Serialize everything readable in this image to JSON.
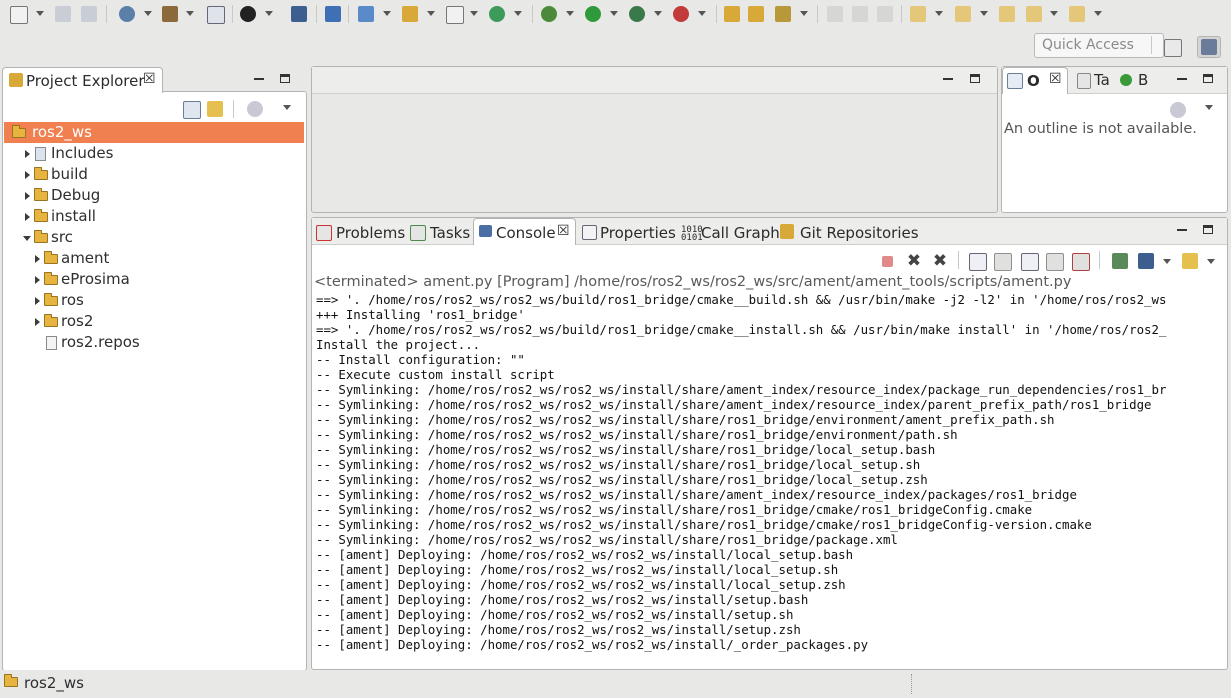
{
  "quick_access": {
    "placeholder": "Quick Access"
  },
  "project_explorer": {
    "title": "Project Explorer",
    "tree": [
      {
        "label": "ros2_ws",
        "kind": "project",
        "selected": true
      },
      {
        "label": "Includes",
        "kind": "includes",
        "expanded": false
      },
      {
        "label": "build",
        "kind": "folder",
        "expanded": false
      },
      {
        "label": "Debug",
        "kind": "folder",
        "expanded": false
      },
      {
        "label": "install",
        "kind": "folder",
        "expanded": false
      },
      {
        "label": "src",
        "kind": "folder",
        "expanded": true
      },
      {
        "label": "ament",
        "kind": "folder",
        "expanded": false
      },
      {
        "label": "eProsima",
        "kind": "folder",
        "expanded": false
      },
      {
        "label": "ros",
        "kind": "folder",
        "expanded": false
      },
      {
        "label": "ros2",
        "kind": "folder",
        "expanded": false
      },
      {
        "label": "ros2.repos",
        "kind": "file"
      }
    ]
  },
  "outline": {
    "tabs": [
      "O",
      "Ta",
      "B"
    ],
    "message": "An outline is not available."
  },
  "bottom_tabs": [
    "Problems",
    "Tasks",
    "Console",
    "Properties",
    "Call Graph",
    "Git Repositories"
  ],
  "console": {
    "header": "<terminated> ament.py [Program] /home/ros/ros2_ws/ros2_ws/src/ament/ament_tools/scripts/ament.py",
    "lines": [
      "==> '. /home/ros/ros2_ws/ros2_ws/build/ros1_bridge/cmake__build.sh && /usr/bin/make -j2 -l2' in '/home/ros/ros2_ws",
      "+++ Installing 'ros1_bridge'",
      "==> '. /home/ros/ros2_ws/ros2_ws/build/ros1_bridge/cmake__install.sh && /usr/bin/make install' in '/home/ros/ros2_",
      "Install the project...",
      "-- Install configuration: \"\"",
      "-- Execute custom install script",
      "-- Symlinking: /home/ros/ros2_ws/ros2_ws/install/share/ament_index/resource_index/package_run_dependencies/ros1_br",
      "-- Symlinking: /home/ros/ros2_ws/ros2_ws/install/share/ament_index/resource_index/parent_prefix_path/ros1_bridge",
      "-- Symlinking: /home/ros/ros2_ws/ros2_ws/install/share/ros1_bridge/environment/ament_prefix_path.sh",
      "-- Symlinking: /home/ros/ros2_ws/ros2_ws/install/share/ros1_bridge/environment/path.sh",
      "-- Symlinking: /home/ros/ros2_ws/ros2_ws/install/share/ros1_bridge/local_setup.bash",
      "-- Symlinking: /home/ros/ros2_ws/ros2_ws/install/share/ros1_bridge/local_setup.sh",
      "-- Symlinking: /home/ros/ros2_ws/ros2_ws/install/share/ros1_bridge/local_setup.zsh",
      "-- Symlinking: /home/ros/ros2_ws/ros2_ws/install/share/ament_index/resource_index/packages/ros1_bridge",
      "-- Symlinking: /home/ros/ros2_ws/ros2_ws/install/share/ros1_bridge/cmake/ros1_bridgeConfig.cmake",
      "-- Symlinking: /home/ros/ros2_ws/ros2_ws/install/share/ros1_bridge/cmake/ros1_bridgeConfig-version.cmake",
      "-- Symlinking: /home/ros/ros2_ws/ros2_ws/install/share/ros1_bridge/package.xml",
      "-- [ament] Deploying: /home/ros/ros2_ws/ros2_ws/install/local_setup.bash",
      "-- [ament] Deploying: /home/ros/ros2_ws/ros2_ws/install/local_setup.sh",
      "-- [ament] Deploying: /home/ros/ros2_ws/ros2_ws/install/local_setup.zsh",
      "-- [ament] Deploying: /home/ros/ros2_ws/ros2_ws/install/setup.bash",
      "-- [ament] Deploying: /home/ros/ros2_ws/ros2_ws/install/setup.sh",
      "-- [ament] Deploying: /home/ros/ros2_ws/ros2_ws/install/setup.zsh",
      "-- [ament] Deploying: /home/ros/ros2_ws/ros2_ws/install/_order_packages.py"
    ]
  },
  "status_bar": {
    "text": "ros2_ws"
  },
  "colors": {
    "selection": "#f08050",
    "terminate_red": "#e05050",
    "run_green": "#2f9a3a"
  }
}
